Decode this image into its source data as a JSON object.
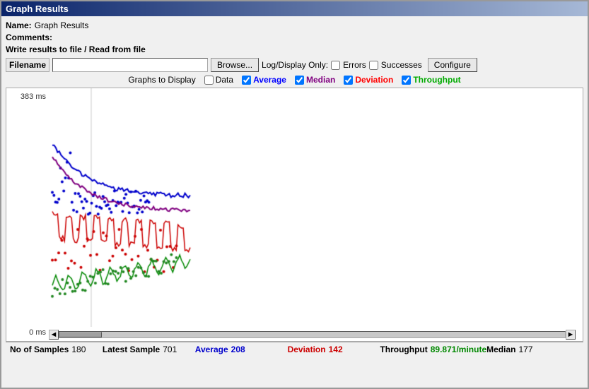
{
  "window": {
    "title": "Graph Results"
  },
  "form": {
    "name_label": "Name:",
    "name_value": "Graph Results",
    "comments_label": "Comments:",
    "file_section_label": "Write results to file / Read from file",
    "filename_label": "Filename",
    "filename_value": "",
    "filename_placeholder": "",
    "browse_label": "Browse...",
    "log_display_label": "Log/Display Only:",
    "errors_label": "Errors",
    "successes_label": "Successes",
    "configure_label": "Configure"
  },
  "graph_controls": {
    "graphs_to_display_label": "Graphs to Display",
    "data_label": "Data",
    "average_label": "Average",
    "median_label": "Median",
    "deviation_label": "Deviation",
    "throughput_label": "Throughput"
  },
  "chart": {
    "y_axis_top": "383 ms",
    "y_axis_bottom": "0 ms"
  },
  "status": {
    "samples_label": "No of Samples",
    "samples_value": "180",
    "latest_label": "Latest Sample",
    "latest_value": "701",
    "average_label": "Average",
    "average_value": "208",
    "deviation_label": "Deviation",
    "deviation_value": "142",
    "throughput_label": "Throughput",
    "throughput_value": "89.871/minute",
    "median_label": "Median",
    "median_value": "177"
  }
}
